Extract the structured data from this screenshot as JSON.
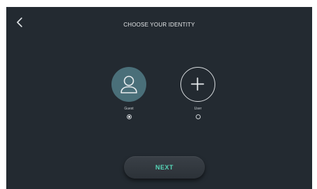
{
  "header": {
    "back_icon": "chevron-left-icon",
    "title": "CHOOSE YOUR IDENTITY"
  },
  "identities": [
    {
      "label": "Guest",
      "icon": "person-icon",
      "selected": true
    },
    {
      "label": "User",
      "icon": "plus-icon",
      "selected": false
    }
  ],
  "footer": {
    "next_label": "NEXT"
  },
  "colors": {
    "background": "#232a31",
    "selected_avatar": "#4a6f79",
    "accent": "#56d6b8"
  }
}
